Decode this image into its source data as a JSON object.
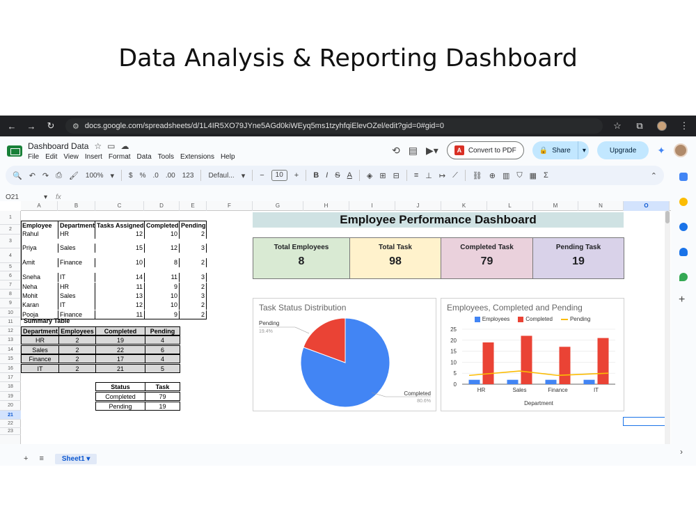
{
  "slide_title": "Data Analysis & Reporting Dashboard",
  "browser": {
    "url": "docs.google.com/spreadsheets/d/1L4IR5XO79JYne5AGd0kiWEyq5ms1tzyhfqiElevOZel/edit?gid=0#gid=0"
  },
  "app": {
    "doc_title": "Dashboard Data",
    "menus": [
      "File",
      "Edit",
      "View",
      "Insert",
      "Format",
      "Data",
      "Tools",
      "Extensions",
      "Help"
    ],
    "convert_label": "Convert to PDF",
    "share_label": "Share",
    "upgrade_label": "Upgrade"
  },
  "toolbar": {
    "zoom": "100%",
    "currency": "$",
    "percent": "%",
    "dec_decrease": ".0",
    "dec_increase": ".00",
    "number_format": "123",
    "font": "Defaul...",
    "font_size": "10"
  },
  "formula_bar": {
    "cell_ref": "O21",
    "fx": "fx"
  },
  "columns": [
    "A",
    "B",
    "C",
    "D",
    "E",
    "F",
    "G",
    "H",
    "I",
    "J",
    "K",
    "L",
    "M",
    "N",
    "O"
  ],
  "rows": [
    "1",
    "2",
    "3",
    "4",
    "5",
    "6",
    "7",
    "8",
    "9",
    "10",
    "11",
    "12",
    "13",
    "14",
    "15",
    "16",
    "17",
    "18",
    "19",
    "20",
    "21",
    "22",
    "23"
  ],
  "employee_table": {
    "headers": [
      "Employee",
      "Department",
      "Tasks Assigned",
      "Completed",
      "Pending"
    ],
    "rows": [
      [
        "Rahul",
        "HR",
        "12",
        "10",
        "2"
      ],
      [
        "Priya",
        "Sales",
        "15",
        "12",
        "3"
      ],
      [
        "Amit",
        "Finance",
        "10",
        "8",
        "2"
      ],
      [
        "Sneha",
        "IT",
        "14",
        "11",
        "3"
      ],
      [
        "Neha",
        "HR",
        "11",
        "9",
        "2"
      ],
      [
        "Mohit",
        "Sales",
        "13",
        "10",
        "3"
      ],
      [
        "Karan",
        "IT",
        "12",
        "10",
        "2"
      ],
      [
        "Pooja",
        "Finance",
        "11",
        "9",
        "2"
      ]
    ]
  },
  "summary_table": {
    "title": "Summary Table",
    "headers": [
      "Department",
      "Employees",
      "Completed",
      "Pending"
    ],
    "rows": [
      [
        "HR",
        "2",
        "19",
        "4"
      ],
      [
        "Sales",
        "2",
        "22",
        "6"
      ],
      [
        "Finance",
        "2",
        "17",
        "4"
      ],
      [
        "IT",
        "2",
        "21",
        "5"
      ]
    ]
  },
  "status_table": {
    "headers": [
      "Status",
      "Task"
    ],
    "rows": [
      [
        "Completed",
        "79"
      ],
      [
        "Pending",
        "19"
      ]
    ]
  },
  "dashboard": {
    "title": "Employee Performance Dashboard",
    "kpis": [
      {
        "label": "Total Employees",
        "value": "8",
        "color": "#d9ead3"
      },
      {
        "label": "Total Task",
        "value": "98",
        "color": "#fff2cc"
      },
      {
        "label": "Completed Task",
        "value": "79",
        "color": "#ead1dc"
      },
      {
        "label": "Pending Task",
        "value": "19",
        "color": "#d9d2e9"
      }
    ]
  },
  "sheet_tab": "Sheet1",
  "chart_data": [
    {
      "type": "pie",
      "title": "Task Status Distribution",
      "labels": [
        "Completed",
        "Pending"
      ],
      "values": [
        79,
        19
      ],
      "percent_labels": [
        "80.6%",
        "19.4%"
      ],
      "colors": [
        "#4285f4",
        "#ea4335"
      ]
    },
    {
      "type": "bar",
      "title": "Employees, Completed and Pending",
      "categories": [
        "HR",
        "Sales",
        "Finance",
        "IT"
      ],
      "xlabel": "Department",
      "ylim": [
        0,
        25
      ],
      "yticks": [
        "0",
        "5",
        "10",
        "15",
        "20",
        "25"
      ],
      "legend_position": "top",
      "series": [
        {
          "name": "Employees",
          "kind": "bar",
          "color": "#4285f4",
          "values": [
            2,
            2,
            2,
            2
          ]
        },
        {
          "name": "Completed",
          "kind": "bar",
          "color": "#ea4335",
          "values": [
            19,
            22,
            17,
            21
          ]
        },
        {
          "name": "Pending",
          "kind": "line",
          "color": "#fbbc04",
          "values": [
            4,
            6,
            4,
            5
          ]
        }
      ]
    }
  ]
}
